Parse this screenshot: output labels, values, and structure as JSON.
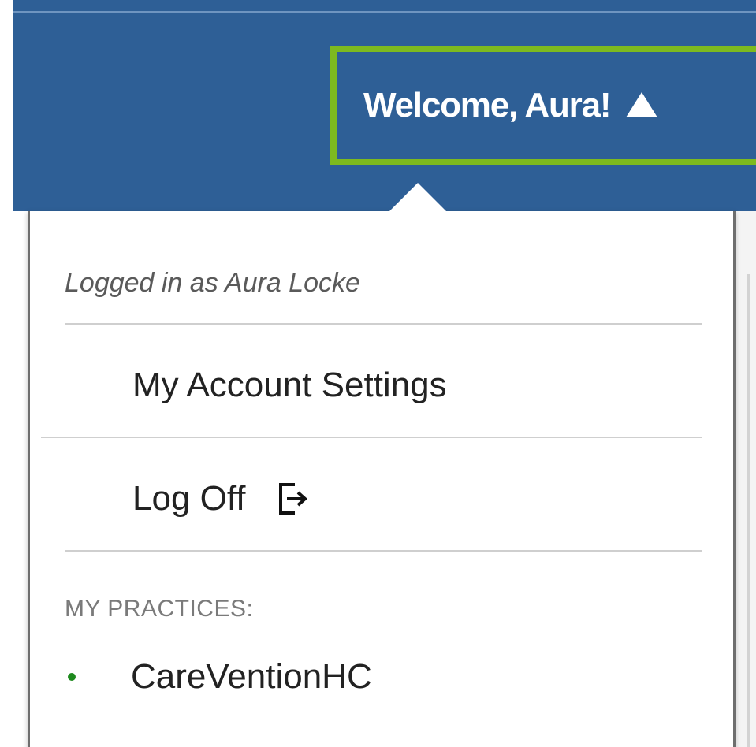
{
  "header": {
    "welcome_text": "Welcome, Aura!",
    "caret_icon": "caret-up-icon",
    "background_color": "#2e5f96",
    "highlight_color": "#7dba1f"
  },
  "user_menu": {
    "logged_in_text": "Logged in as Aura Locke",
    "items": [
      {
        "label": "My Account Settings",
        "icon": ""
      },
      {
        "label": "Log Off",
        "icon": "log-off-icon"
      }
    ],
    "practices_label": "MY PRACTICES:",
    "practices": [
      {
        "name": "CareVentionHC",
        "active": true,
        "status_color": "#1e8a1e"
      }
    ]
  }
}
